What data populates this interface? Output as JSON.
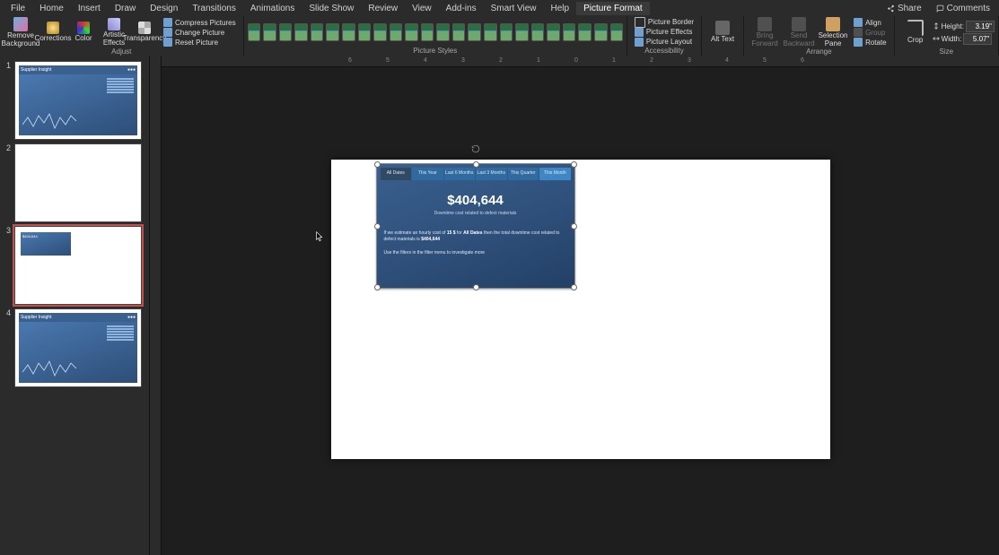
{
  "tabs": [
    "File",
    "Home",
    "Insert",
    "Draw",
    "Design",
    "Transitions",
    "Animations",
    "Slide Show",
    "Review",
    "View",
    "Add-ins",
    "Smart View",
    "Help",
    "Picture Format"
  ],
  "active_tab": "Picture Format",
  "titlebar": {
    "share": "Share",
    "comments": "Comments"
  },
  "ribbon": {
    "adjust": {
      "label": "Adjust",
      "remove_bg": "Remove Background",
      "corrections": "Corrections",
      "color": "Color",
      "artistic": "Artistic Effects",
      "transparency": "Transparency",
      "compress": "Compress Pictures",
      "change": "Change Picture",
      "reset": "Reset Picture"
    },
    "styles": {
      "label": "Picture Styles"
    },
    "accessibility": {
      "label": "Accessibility",
      "alt": "Alt Text"
    },
    "arrange": {
      "label": "Arrange",
      "border": "Picture Border",
      "effects": "Picture Effects",
      "layout": "Picture Layout",
      "bring": "Bring Forward",
      "send": "Send Backward",
      "selection": "Selection Pane",
      "align": "Align",
      "group": "Group",
      "rotate": "Rotate"
    },
    "size": {
      "label": "Size",
      "crop": "Crop",
      "height_label": "Height:",
      "width_label": "Width:",
      "height": "3.19\"",
      "width": "5.07\""
    }
  },
  "slides": [
    {
      "num": "1",
      "title": "Supplier Insight"
    },
    {
      "num": "2",
      "title": ""
    },
    {
      "num": "3",
      "title": "$404,644"
    },
    {
      "num": "4",
      "title": "Supplier Insight"
    }
  ],
  "selected_slide": 3,
  "image": {
    "tabs": [
      "All Dates",
      "This Year",
      "Last 6 Months",
      "Last 3 Months",
      "This Quarter",
      "This Month"
    ],
    "value": "$404,644",
    "subtitle": "Downtime cost related to defect materials",
    "line1a": "If we estimate an hourly cost of ",
    "line1b": "15 $",
    "line1c": " for ",
    "line1d": "All Dates",
    "line1e": " then the total downtime cost related to defect materials is ",
    "line1f": "$404,644",
    "line2": "Use the filters in the filter menu to investigate more"
  },
  "ruler_nums": [
    "6",
    "5",
    "4",
    "3",
    "2",
    "1",
    "0",
    "1",
    "2",
    "3",
    "4",
    "5",
    "6"
  ]
}
